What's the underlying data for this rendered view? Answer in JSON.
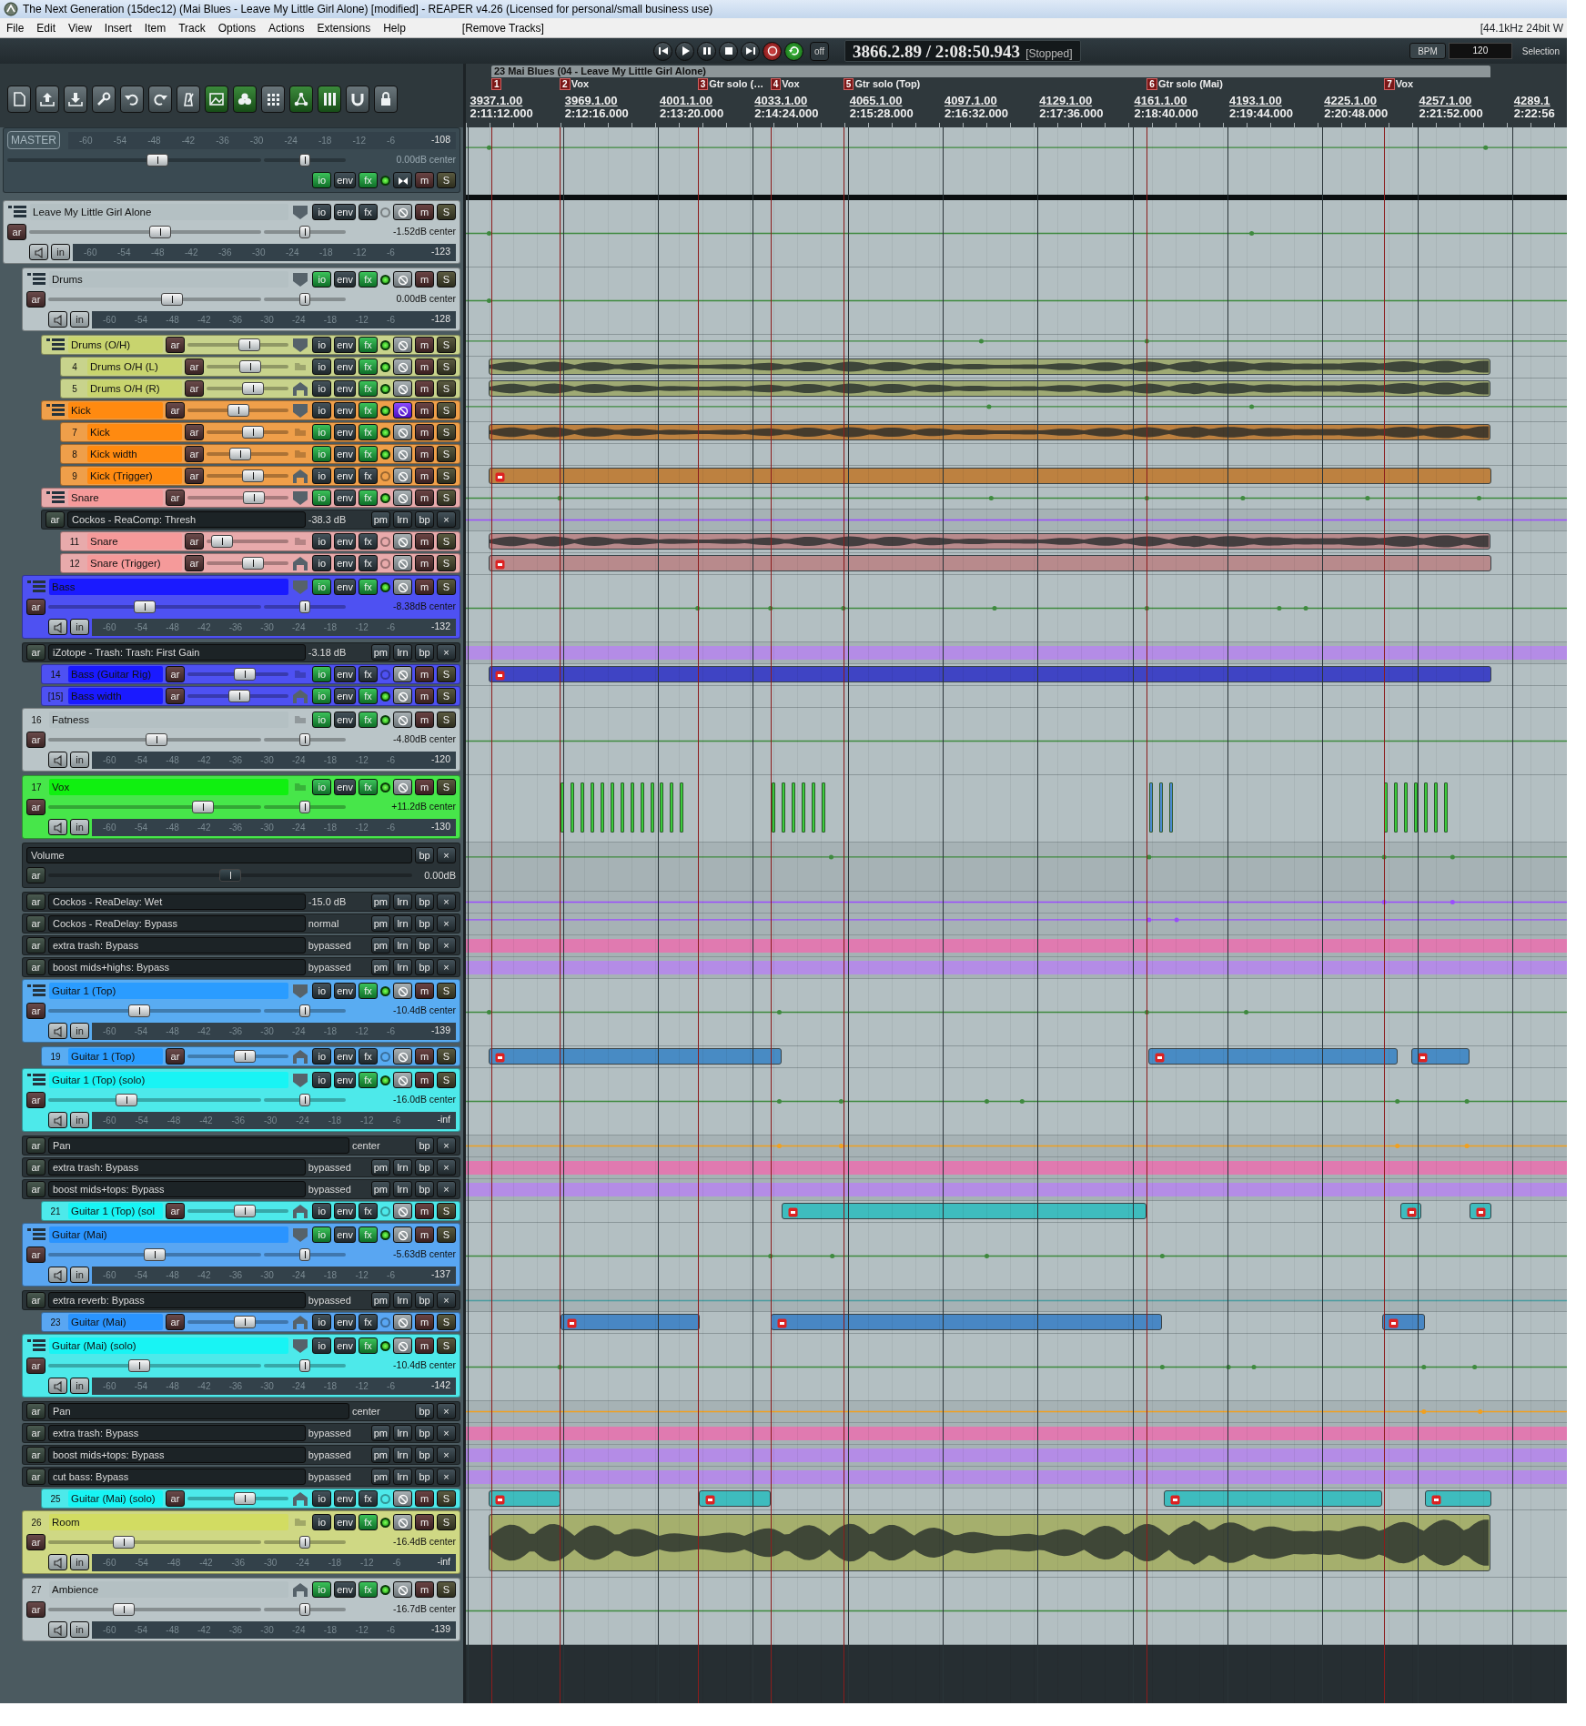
{
  "window": {
    "title": "The Next Generation (15dec12) (Mai Blues - Leave My Little Girl Alone) [modified] - REAPER v4.26 (Licensed for personal/small business use)"
  },
  "menu": [
    "File",
    "Edit",
    "View",
    "Insert",
    "Item",
    "Track",
    "Options",
    "Actions",
    "Extensions",
    "Help"
  ],
  "menu_action": "[Remove Tracks]",
  "status": "[44.1kHz 24bit W",
  "transport": {
    "buttons": [
      {
        "kind": "start"
      },
      {
        "kind": "play"
      },
      {
        "kind": "pause"
      },
      {
        "kind": "stop"
      },
      {
        "kind": "end"
      },
      {
        "kind": "record"
      },
      {
        "kind": "repeat"
      }
    ],
    "off_label": "off",
    "position": "3866.2.89 / 2:08:50.943",
    "state": "[Stopped]",
    "bpm_label": "BPM",
    "bpm": "120",
    "selection_label": "Selection"
  },
  "toolbar": [
    {
      "kind": "new",
      "on": false
    },
    {
      "kind": "open",
      "on": false
    },
    {
      "kind": "save",
      "on": false
    },
    {
      "kind": "settings",
      "on": false
    },
    {
      "kind": "undo",
      "on": false
    },
    {
      "kind": "redo",
      "on": false
    },
    {
      "kind": "metronome",
      "on": false
    },
    {
      "kind": "snap",
      "on": true
    },
    {
      "kind": "clover",
      "on": true
    },
    {
      "kind": "grid",
      "on": false
    },
    {
      "kind": "nodes",
      "on": true
    },
    {
      "kind": "bars",
      "on": true
    },
    {
      "kind": "magnet",
      "on": false
    },
    {
      "kind": "lock",
      "on": false
    }
  ],
  "ruler": {
    "region": "23 Mai Blues (04 - Leave My Little Girl Alone)",
    "markers": [
      {
        "number": "1"
      },
      {
        "number": "2",
        "label": "Vox"
      },
      {
        "number": "3",
        "label": "Gtr solo (…"
      },
      {
        "number": "4",
        "label": "Vox"
      },
      {
        "number": "5",
        "label": "Gtr solo (Top)"
      },
      {
        "number": "6",
        "label": "Gtr solo (Mai)"
      },
      {
        "number": "7",
        "label": "Vox"
      }
    ],
    "times": [
      {
        "bar": "3937.1.00",
        "time": "2:11:12.000"
      },
      {
        "bar": "3969.1.00",
        "time": "2:12:16.000"
      },
      {
        "bar": "4001.1.00",
        "time": "2:13:20.000"
      },
      {
        "bar": "4033.1.00",
        "time": "2:14:24.000"
      },
      {
        "bar": "4065.1.00",
        "time": "2:15:28.000"
      },
      {
        "bar": "4097.1.00",
        "time": "2:16:32.000"
      },
      {
        "bar": "4129.1.00",
        "time": "2:17:36.000"
      },
      {
        "bar": "4161.1.00",
        "time": "2:18:40.000"
      },
      {
        "bar": "4193.1.00",
        "time": "2:19:44.000"
      },
      {
        "bar": "4225.1.00",
        "time": "2:20:48.000"
      },
      {
        "bar": "4257.1.00",
        "time": "2:21:52.000"
      },
      {
        "bar": "4289.1",
        "time": "2:22:56"
      }
    ]
  },
  "master": {
    "label": "MASTER",
    "volume": {
      "level": 0.6
    },
    "pan": {
      "level": 0.5
    },
    "readout": "0.00dB center",
    "meter": {
      "ticks": [
        "-60",
        "-54",
        "-48",
        "-42",
        "-36",
        "-30",
        "-24",
        "-18",
        "-12",
        "-6"
      ],
      "peak": "-108"
    },
    "buttons": [
      {
        "label": "io",
        "on": true
      },
      {
        "label": "env",
        "on": false
      },
      {
        "label": "fx",
        "on": true
      },
      {
        "label": "m",
        "on": false
      },
      {
        "label": "S",
        "on": false
      }
    ]
  },
  "tracks": [
    {
      "kind": "big",
      "name": "Leave My Little Girl Alone",
      "color": "#b4c0c3",
      "arm": "ar",
      "input": "in",
      "volume": {
        "level": 0.57
      },
      "pan": {
        "level": 0.5
      },
      "readout": "-1.52dB center",
      "meter": {
        "ticks": [
          "-60",
          "-54",
          "-48",
          "-42",
          "-36",
          "-30",
          "-24",
          "-18",
          "-12",
          "-6"
        ],
        "peak": "-123"
      },
      "monitor": false,
      "buttons": [
        {
          "label": "io",
          "on": false
        },
        {
          "label": "env",
          "on": false
        },
        {
          "label": "fx",
          "on": false
        },
        {
          "label": "m",
          "on": false
        },
        {
          "label": "S",
          "on": false
        }
      ],
      "children": [
        {
          "kind": "big",
          "name": "Drums",
          "color": "#b4c0c3",
          "arm": "ar",
          "input": "in",
          "volume": {
            "level": 0.59
          },
          "pan": {
            "level": 0.5
          },
          "readout": "0.00dB center",
          "meter": {
            "ticks": [
              "-60",
              "-54",
              "-48",
              "-42",
              "-36",
              "-30",
              "-24",
              "-18",
              "-12",
              "-6"
            ],
            "peak": "-128"
          },
          "monitor": false,
          "buttons": [
            {
              "label": "io",
              "on": true
            },
            {
              "label": "env",
              "on": false
            },
            {
              "label": "fx",
              "on": true
            },
            {
              "label": "m",
              "on": false
            },
            {
              "label": "S",
              "on": false
            }
          ],
          "children": [
            {
              "kind": "small",
              "name": "Drums (O/H)",
              "color": "#c8d46e",
              "arm": "ar",
              "volume": {
                "level": 0.64
              },
              "monitor": false,
              "buttons": [
                {
                  "label": "io",
                  "on": false
                },
                {
                  "label": "env",
                  "on": false
                },
                {
                  "label": "fx",
                  "on": true
                },
                {
                  "label": "m",
                  "on": false
                },
                {
                  "label": "S",
                  "on": false
                }
              ],
              "children": [
                {
                  "kind": "small",
                  "number": "4",
                  "name": "Drums O/H (L)",
                  "color": "#c8d46e",
                  "arm": "ar",
                  "volume": {
                    "level": 0.55
                  },
                  "monitor": false,
                  "buttons": [
                    {
                      "label": "io",
                      "on": false
                    },
                    {
                      "label": "env",
                      "on": false
                    },
                    {
                      "label": "fx",
                      "on": true
                    },
                    {
                      "label": "m",
                      "on": false
                    },
                    {
                      "label": "S",
                      "on": false
                    }
                  ]
                },
                {
                  "kind": "small",
                  "number": "5",
                  "name": "Drums O/H (R)",
                  "color": "#c8d46e",
                  "arm": "ar",
                  "volume": {
                    "level": 0.59
                  },
                  "monitor": false,
                  "buttons": [
                    {
                      "label": "io",
                      "on": false
                    },
                    {
                      "label": "env",
                      "on": false
                    },
                    {
                      "label": "fx",
                      "on": true
                    },
                    {
                      "label": "m",
                      "on": false
                    },
                    {
                      "label": "S",
                      "on": false
                    }
                  ]
                }
              ]
            },
            {
              "kind": "small",
              "name": "Kick",
              "color": "#ff8a10",
              "arm": "ar",
              "volume": {
                "level": 0.5
              },
              "monitor": true,
              "buttons": [
                {
                  "label": "io",
                  "on": false
                },
                {
                  "label": "env",
                  "on": false
                },
                {
                  "label": "fx",
                  "on": true
                },
                {
                  "label": "m",
                  "on": false
                },
                {
                  "label": "S",
                  "on": false
                }
              ],
              "children": [
                {
                  "kind": "small",
                  "number": "7",
                  "name": "Kick",
                  "color": "#ff8a10",
                  "arm": "ar",
                  "volume": {
                    "level": 0.59
                  },
                  "monitor": false,
                  "buttons": [
                    {
                      "label": "io",
                      "on": true
                    },
                    {
                      "label": "env",
                      "on": false
                    },
                    {
                      "label": "fx",
                      "on": true
                    },
                    {
                      "label": "m",
                      "on": false
                    },
                    {
                      "label": "S",
                      "on": false
                    }
                  ]
                },
                {
                  "kind": "small",
                  "number": "8",
                  "name": "Kick width",
                  "color": "#ff8a10",
                  "arm": "ar",
                  "volume": {
                    "level": 0.37
                  },
                  "monitor": false,
                  "buttons": [
                    {
                      "label": "io",
                      "on": true
                    },
                    {
                      "label": "env",
                      "on": false
                    },
                    {
                      "label": "fx",
                      "on": true
                    },
                    {
                      "label": "m",
                      "on": false
                    },
                    {
                      "label": "S",
                      "on": false
                    }
                  ]
                },
                {
                  "kind": "small",
                  "number": "9",
                  "name": "Kick (Trigger)",
                  "color": "#ff8a10",
                  "arm": "ar",
                  "volume": {
                    "level": 0.59
                  },
                  "monitor": false,
                  "buttons": [
                    {
                      "label": "io",
                      "on": false
                    },
                    {
                      "label": "env",
                      "on": false
                    },
                    {
                      "label": "fx",
                      "on": false
                    },
                    {
                      "label": "m",
                      "on": false
                    },
                    {
                      "label": "S",
                      "on": false
                    }
                  ]
                }
              ]
            },
            {
              "kind": "small",
              "name": "Snare",
              "color": "#f59a9a",
              "arm": "ar",
              "volume": {
                "level": 0.7
              },
              "monitor": false,
              "buttons": [
                {
                  "label": "io",
                  "on": true
                },
                {
                  "label": "env",
                  "on": false
                },
                {
                  "label": "fx",
                  "on": true
                },
                {
                  "label": "m",
                  "on": false
                },
                {
                  "label": "S",
                  "on": false
                }
              ],
              "envelopes": [
                {
                  "kind": "param",
                  "arm": "ar",
                  "name": "Cockos - ReaComp: Thresh",
                  "value": "-38.3 dB",
                  "buttons": [
                    "pm",
                    "lrn",
                    "bp",
                    "×"
                  ]
                }
              ],
              "children": [
                {
                  "kind": "small",
                  "number": "11",
                  "name": "Snare",
                  "color": "#f59a9a",
                  "arm": "ar",
                  "volume": {
                    "level": 0.07
                  },
                  "monitor": false,
                  "buttons": [
                    {
                      "label": "io",
                      "on": false
                    },
                    {
                      "label": "env",
                      "on": false
                    },
                    {
                      "label": "fx",
                      "on": false
                    },
                    {
                      "label": "m",
                      "on": false
                    },
                    {
                      "label": "S",
                      "on": false
                    }
                  ]
                },
                {
                  "kind": "small",
                  "number": "12",
                  "name": "Snare (Trigger)",
                  "color": "#f59a9a",
                  "arm": "ar",
                  "volume": {
                    "level": 0.59
                  },
                  "monitor": false,
                  "buttons": [
                    {
                      "label": "io",
                      "on": false
                    },
                    {
                      "label": "env",
                      "on": false
                    },
                    {
                      "label": "fx",
                      "on": false
                    },
                    {
                      "label": "m",
                      "on": false
                    },
                    {
                      "label": "S",
                      "on": false
                    }
                  ]
                }
              ]
            }
          ]
        },
        {
          "kind": "big",
          "name": "Bass",
          "color": "#1a1aff",
          "arm": "ar",
          "input": "in",
          "volume": {
            "level": 0.45
          },
          "pan": {
            "level": 0.5
          },
          "readout": "-8.38dB center",
          "meter": {
            "ticks": [
              "-60",
              "-54",
              "-48",
              "-42",
              "-36",
              "-30",
              "-24",
              "-18",
              "-12",
              "-6"
            ],
            "peak": "-132"
          },
          "monitor": false,
          "buttons": [
            {
              "label": "io",
              "on": true
            },
            {
              "label": "env",
              "on": false
            },
            {
              "label": "fx",
              "on": true
            },
            {
              "label": "m",
              "on": false
            },
            {
              "label": "S",
              "on": false
            }
          ],
          "envelopes": [
            {
              "kind": "param",
              "arm": "ar",
              "name": "iZotope - Trash: Trash: First Gain",
              "value": "-3.18 dB",
              "buttons": [
                "pm",
                "lrn",
                "bp",
                "×"
              ]
            }
          ],
          "children": [
            {
              "kind": "small",
              "number": "14",
              "name": "Bass (Guitar Rig)",
              "color": "#1a1aff",
              "arm": "ar",
              "volume": {
                "level": 0.59
              },
              "monitor": false,
              "buttons": [
                {
                  "label": "io",
                  "on": true
                },
                {
                  "label": "env",
                  "on": false
                },
                {
                  "label": "fx",
                  "on": false
                },
                {
                  "label": "m",
                  "on": false
                },
                {
                  "label": "S",
                  "on": false
                }
              ]
            },
            {
              "kind": "small",
              "number": "[15]",
              "name": "Bass width",
              "color": "#1a1aff",
              "arm": "ar",
              "volume": {
                "level": 0.52
              },
              "monitor": false,
              "buttons": [
                {
                  "label": "io",
                  "on": true
                },
                {
                  "label": "env",
                  "on": false
                },
                {
                  "label": "fx",
                  "on": true
                },
                {
                  "label": "m",
                  "on": false
                },
                {
                  "label": "S",
                  "on": false
                }
              ]
            }
          ]
        },
        {
          "kind": "big",
          "number": "16",
          "name": "Fatness",
          "color": "#b4c0c3",
          "arm": "ar",
          "input": "in",
          "volume": {
            "level": 0.51
          },
          "pan": {
            "level": 0.5
          },
          "readout": "-4.80dB center",
          "meter": {
            "ticks": [
              "-60",
              "-54",
              "-48",
              "-42",
              "-36",
              "-30",
              "-24",
              "-18",
              "-12",
              "-6"
            ],
            "peak": "-120"
          },
          "monitor": false,
          "buttons": [
            {
              "label": "io",
              "on": true
            },
            {
              "label": "env",
              "on": false
            },
            {
              "label": "fx",
              "on": true
            },
            {
              "label": "m",
              "on": false
            },
            {
              "label": "S",
              "on": false
            }
          ]
        },
        {
          "kind": "big",
          "number": "17",
          "name": "Vox",
          "color": "#10f010",
          "arm": "ar",
          "input": "in",
          "volume": {
            "level": 0.75
          },
          "pan": {
            "level": 0.5
          },
          "readout": "+11.2dB center",
          "meter": {
            "ticks": [
              "-60",
              "-54",
              "-48",
              "-42",
              "-36",
              "-30",
              "-24",
              "-18",
              "-12",
              "-6"
            ],
            "peak": "-130"
          },
          "monitor": false,
          "buttons": [
            {
              "label": "io",
              "on": true
            },
            {
              "label": "env",
              "on": false
            },
            {
              "label": "fx",
              "on": true
            },
            {
              "label": "m",
              "on": false
            },
            {
              "label": "S",
              "on": false
            }
          ],
          "envelopes": [
            {
              "kind": "volume",
              "arm": "ar",
              "name": "Volume",
              "value": "0.00dB",
              "fader": {
                "level": 0.5
              },
              "buttons": [
                "bp",
                "×"
              ]
            },
            {
              "kind": "param",
              "arm": "ar",
              "name": "Cockos - ReaDelay: Wet",
              "value": "-15.0 dB",
              "buttons": [
                "pm",
                "lrn",
                "bp",
                "×"
              ]
            },
            {
              "kind": "param",
              "arm": "ar",
              "name": "Cockos - ReaDelay: Bypass",
              "value": "normal",
              "buttons": [
                "pm",
                "lrn",
                "bp",
                "×"
              ]
            },
            {
              "kind": "param",
              "arm": "ar",
              "name": "extra trash: Bypass",
              "value": "bypassed",
              "buttons": [
                "pm",
                "lrn",
                "bp",
                "×"
              ]
            },
            {
              "kind": "param",
              "arm": "ar",
              "name": "boost mids+highs: Bypass",
              "value": "bypassed",
              "buttons": [
                "pm",
                "lrn",
                "bp",
                "×"
              ]
            }
          ]
        },
        {
          "kind": "big",
          "name": "Guitar 1 (Top)",
          "color": "#2a9cff",
          "arm": "ar",
          "input": "in",
          "volume": {
            "level": 0.42
          },
          "pan": {
            "level": 0.5
          },
          "readout": "-10.4dB center",
          "meter": {
            "ticks": [
              "-60",
              "-54",
              "-48",
              "-42",
              "-36",
              "-30",
              "-24",
              "-18",
              "-12",
              "-6"
            ],
            "peak": "-139"
          },
          "monitor": false,
          "buttons": [
            {
              "label": "io",
              "on": false
            },
            {
              "label": "env",
              "on": false
            },
            {
              "label": "fx",
              "on": true
            },
            {
              "label": "m",
              "on": false
            },
            {
              "label": "S",
              "on": false
            }
          ],
          "children": [
            {
              "kind": "small",
              "number": "19",
              "name": "Guitar 1 (Top)",
              "color": "#2a9cff",
              "arm": "ar",
              "volume": {
                "level": 0.59
              },
              "monitor": false,
              "buttons": [
                {
                  "label": "io",
                  "on": false
                },
                {
                  "label": "env",
                  "on": false
                },
                {
                  "label": "fx",
                  "on": false
                },
                {
                  "label": "m",
                  "on": false
                },
                {
                  "label": "S",
                  "on": false
                }
              ]
            }
          ]
        },
        {
          "kind": "big",
          "name": "Guitar 1 (Top) (solo)",
          "color": "#18f4f4",
          "arm": "ar",
          "input": "in",
          "volume": {
            "level": 0.35
          },
          "pan": {
            "level": 0.5
          },
          "readout": "-16.0dB center",
          "meter": {
            "ticks": [
              "-60",
              "-54",
              "-48",
              "-42",
              "-36",
              "-30",
              "-24",
              "-18",
              "-12",
              "-6"
            ],
            "peak": "-inf"
          },
          "monitor": false,
          "buttons": [
            {
              "label": "io",
              "on": false
            },
            {
              "label": "env",
              "on": false
            },
            {
              "label": "fx",
              "on": true
            },
            {
              "label": "m",
              "on": false
            },
            {
              "label": "S",
              "on": false
            }
          ],
          "envelopes": [
            {
              "kind": "param",
              "arm": "ar",
              "name": "Pan",
              "value": "center",
              "buttons": [
                "bp",
                "×"
              ]
            },
            {
              "kind": "param",
              "arm": "ar",
              "name": "extra trash: Bypass",
              "value": "bypassed",
              "buttons": [
                "pm",
                "lrn",
                "bp",
                "×"
              ]
            },
            {
              "kind": "param",
              "arm": "ar",
              "name": "boost mids+tops: Bypass",
              "value": "bypassed",
              "buttons": [
                "pm",
                "lrn",
                "bp",
                "×"
              ]
            }
          ],
          "children": [
            {
              "kind": "small",
              "number": "21",
              "name": "Guitar 1 (Top) (sol",
              "color": "#18f4f4",
              "arm": "ar",
              "volume": {
                "level": 0.59
              },
              "monitor": false,
              "buttons": [
                {
                  "label": "io",
                  "on": false
                },
                {
                  "label": "env",
                  "on": false
                },
                {
                  "label": "fx",
                  "on": false
                },
                {
                  "label": "m",
                  "on": false
                },
                {
                  "label": "S",
                  "on": false
                }
              ]
            }
          ]
        },
        {
          "kind": "big",
          "name": "Guitar (Mai)",
          "color": "#2a94ff",
          "arm": "ar",
          "input": "in",
          "volume": {
            "level": 0.5
          },
          "pan": {
            "level": 0.5
          },
          "readout": "-5.63dB center",
          "meter": {
            "ticks": [
              "-60",
              "-54",
              "-48",
              "-42",
              "-36",
              "-30",
              "-24",
              "-18",
              "-12",
              "-6"
            ],
            "peak": "-137"
          },
          "monitor": false,
          "buttons": [
            {
              "label": "io",
              "on": true
            },
            {
              "label": "env",
              "on": false
            },
            {
              "label": "fx",
              "on": true
            },
            {
              "label": "m",
              "on": false
            },
            {
              "label": "S",
              "on": false
            }
          ],
          "envelopes": [
            {
              "kind": "param",
              "arm": "ar",
              "name": "extra reverb: Bypass",
              "value": "bypassed",
              "buttons": [
                "pm",
                "lrn",
                "bp",
                "×"
              ]
            }
          ],
          "children": [
            {
              "kind": "small",
              "number": "23",
              "name": "Guitar (Mai)",
              "color": "#2a94ff",
              "arm": "ar",
              "volume": {
                "level": 0.59
              },
              "monitor": false,
              "buttons": [
                {
                  "label": "io",
                  "on": false
                },
                {
                  "label": "env",
                  "on": false
                },
                {
                  "label": "fx",
                  "on": false
                },
                {
                  "label": "m",
                  "on": false
                },
                {
                  "label": "S",
                  "on": false
                }
              ]
            }
          ]
        },
        {
          "kind": "big",
          "name": "Guitar (Mai) (solo)",
          "color": "#18f4f4",
          "arm": "ar",
          "input": "in",
          "volume": {
            "level": 0.42
          },
          "pan": {
            "level": 0.5
          },
          "readout": "-10.4dB center",
          "meter": {
            "ticks": [
              "-60",
              "-54",
              "-48",
              "-42",
              "-36",
              "-30",
              "-24",
              "-18",
              "-12",
              "-6"
            ],
            "peak": "-142"
          },
          "monitor": false,
          "buttons": [
            {
              "label": "io",
              "on": false
            },
            {
              "label": "env",
              "on": false
            },
            {
              "label": "fx",
              "on": true
            },
            {
              "label": "m",
              "on": false
            },
            {
              "label": "S",
              "on": false
            }
          ],
          "envelopes": [
            {
              "kind": "param",
              "arm": "ar",
              "name": "Pan",
              "value": "center",
              "buttons": [
                "bp",
                "×"
              ]
            },
            {
              "kind": "param",
              "arm": "ar",
              "name": "extra trash: Bypass",
              "value": "bypassed",
              "buttons": [
                "pm",
                "lrn",
                "bp",
                "×"
              ]
            },
            {
              "kind": "param",
              "arm": "ar",
              "name": "boost mids+tops: Bypass",
              "value": "bypassed",
              "buttons": [
                "pm",
                "lrn",
                "bp",
                "×"
              ]
            },
            {
              "kind": "param",
              "arm": "ar",
              "name": "cut bass: Bypass",
              "value": "bypassed",
              "buttons": [
                "pm",
                "lrn",
                "bp",
                "×"
              ]
            }
          ],
          "children": [
            {
              "kind": "small",
              "number": "25",
              "name": "Guitar (Mai) (solo)",
              "color": "#18f4f4",
              "arm": "ar",
              "volume": {
                "level": 0.59
              },
              "monitor": false,
              "buttons": [
                {
                  "label": "io",
                  "on": false
                },
                {
                  "label": "env",
                  "on": false
                },
                {
                  "label": "fx",
                  "on": false
                },
                {
                  "label": "m",
                  "on": false
                },
                {
                  "label": "S",
                  "on": false
                }
              ]
            }
          ]
        },
        {
          "kind": "big",
          "number": "26",
          "name": "Room",
          "color": "#d2dc62",
          "arm": "ar",
          "input": "in",
          "volume": {
            "level": 0.34
          },
          "pan": {
            "level": 0.5
          },
          "readout": "-16.4dB center",
          "meter": {
            "ticks": [
              "-60",
              "-54",
              "-48",
              "-42",
              "-36",
              "-30",
              "-24",
              "-18",
              "-12",
              "-6"
            ],
            "peak": "-inf"
          },
          "monitor": false,
          "buttons": [
            {
              "label": "io",
              "on": false
            },
            {
              "label": "env",
              "on": false
            },
            {
              "label": "fx",
              "on": true
            },
            {
              "label": "m",
              "on": false
            },
            {
              "label": "S",
              "on": false
            }
          ]
        },
        {
          "kind": "big",
          "number": "27",
          "name": "Ambience",
          "color": "#b4c0c3",
          "arm": "ar",
          "input": "in",
          "volume": {
            "level": 0.34
          },
          "pan": {
            "level": 0.5
          },
          "readout": "-16.7dB center",
          "meter": {
            "ticks": [
              "-60",
              "-54",
              "-48",
              "-42",
              "-36",
              "-30",
              "-24",
              "-18",
              "-12",
              "-6"
            ],
            "peak": "-139"
          },
          "monitor": false,
          "buttons": [
            {
              "label": "io",
              "on": true
            },
            {
              "label": "env",
              "on": false
            },
            {
              "label": "fx",
              "on": true
            },
            {
              "label": "m",
              "on": false
            },
            {
              "label": "S",
              "on": false
            }
          ]
        }
      ]
    }
  ]
}
